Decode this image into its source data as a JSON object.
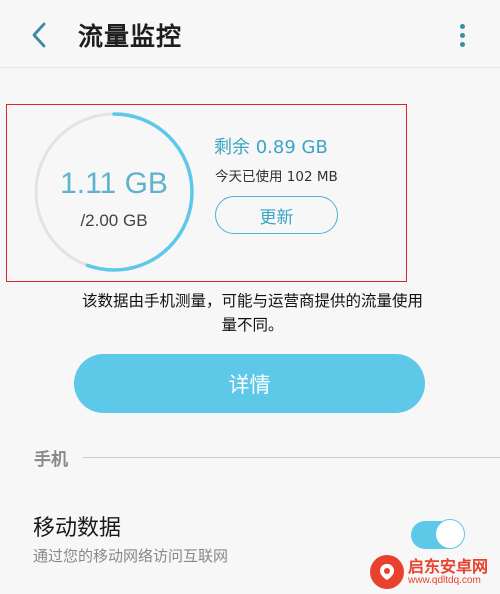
{
  "header": {
    "title": "流量监控",
    "back_icon": "back-arrow-icon",
    "more_icon": "more-vertical-icon"
  },
  "usage": {
    "used": "1.11 GB",
    "total": "/2.00 GB",
    "used_fraction": 0.555,
    "remaining": "剩余 0.89 GB",
    "today_used": "今天已使用 102 MB",
    "update_label": "更新"
  },
  "disclaimer": "该数据由手机测量，可能与运营商提供的流量使用量不同。",
  "details_label": "详情",
  "section": {
    "label": "手机"
  },
  "mobile_data": {
    "title": "移动数据",
    "subtitle": "通过您的移动网络访问互联网",
    "enabled": true
  },
  "watermark": {
    "name": "启东安卓网",
    "url": "www.qdltdq.com"
  },
  "colors": {
    "accent": "#5ec8e8",
    "accent_text": "#3aa6c5",
    "highlight_border": "#d62a2a"
  }
}
